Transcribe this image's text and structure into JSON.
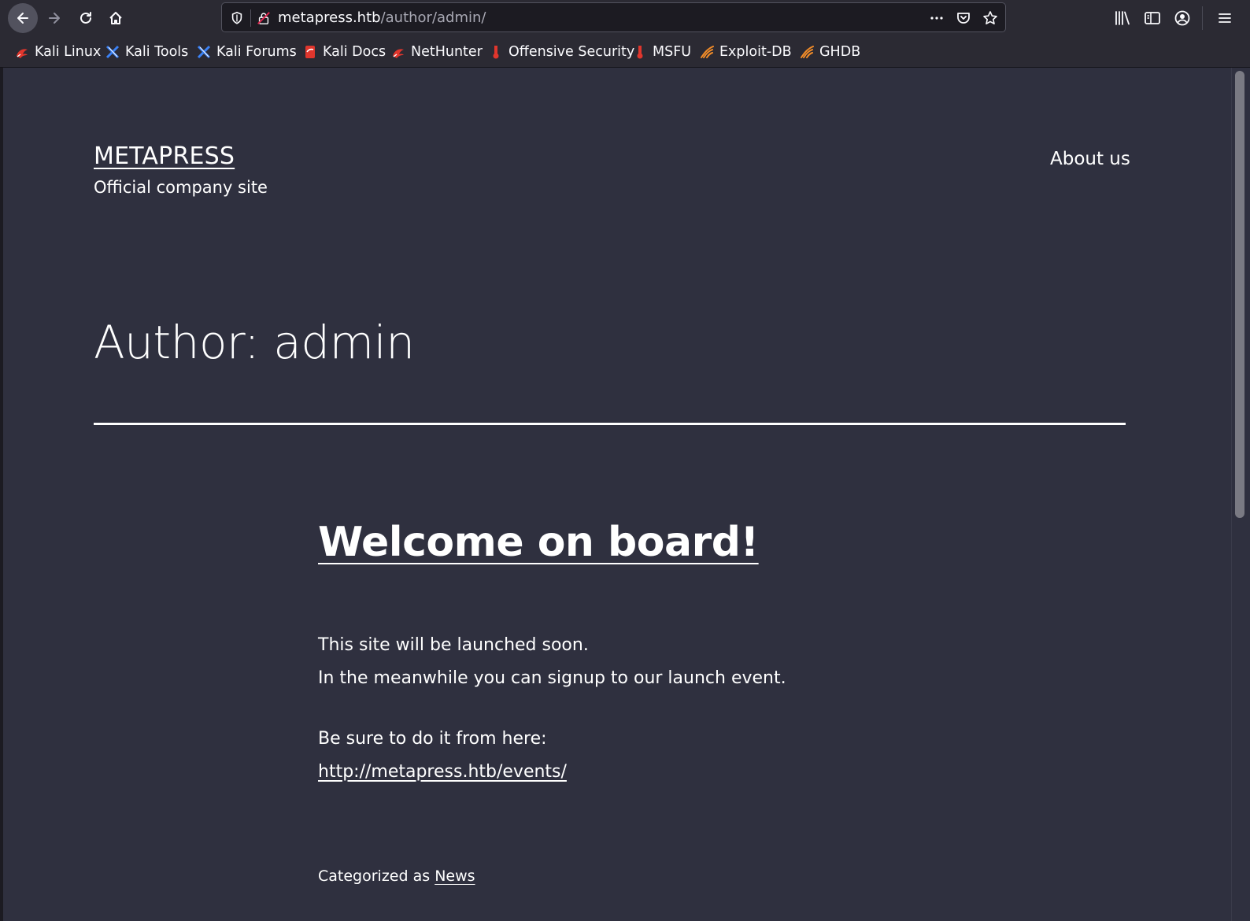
{
  "browser": {
    "url_host": "metapress.htb",
    "url_path": "/author/admin/",
    "nav_icons": [
      "back-icon",
      "forward-icon",
      "reload-icon",
      "home-icon"
    ],
    "toolbar_icons": [
      "library-icon",
      "sidebar-icon",
      "account-icon",
      "menu-icon"
    ]
  },
  "bookmarks": [
    {
      "label": "Kali Linux",
      "icon": "kali-dragon-icon",
      "color": "#e0362d"
    },
    {
      "label": "Kali Tools",
      "icon": "kali-tools-icon",
      "color": "#3b82f6"
    },
    {
      "label": "Kali Forums",
      "icon": "kali-forums-icon",
      "color": "#3b82f6"
    },
    {
      "label": "Kali Docs",
      "icon": "kali-docs-icon",
      "color": "#e0362d"
    },
    {
      "label": "NetHunter",
      "icon": "nethunter-icon",
      "color": "#e0362d"
    },
    {
      "label": "Offensive Security",
      "icon": "offsec-icon",
      "color": "#e0362d"
    },
    {
      "label": "MSFU",
      "icon": "msfu-icon",
      "color": "#e0362d"
    },
    {
      "label": "Exploit-DB",
      "icon": "exploit-db-icon",
      "color": "#f28c28"
    },
    {
      "label": "GHDB",
      "icon": "ghdb-icon",
      "color": "#f28c28"
    }
  ],
  "site": {
    "title": "METAPRESS",
    "description": "Official company site",
    "nav_about": "About us"
  },
  "archive": {
    "title": "Author: admin"
  },
  "post": {
    "title": "Welcome on board!",
    "line1": "This site will be launched soon.",
    "line2": "In the meanwhile you can signup to our launch event.",
    "line3": "Be sure to do it from here:",
    "link": "http://metapress.htb/events/",
    "category_prefix": "Categorized as",
    "category": "News"
  },
  "colors": {
    "page_bg": "#2f303f",
    "chrome_bg": "#2b2a33",
    "text": "#ffffff"
  }
}
